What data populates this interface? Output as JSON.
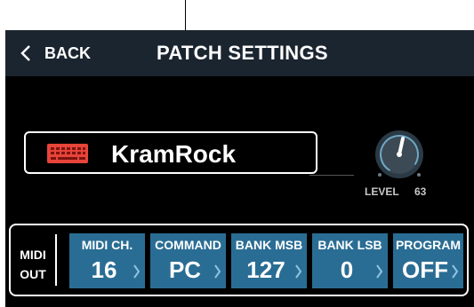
{
  "header": {
    "back_label": "BACK",
    "title": "PATCH SETTINGS"
  },
  "patch": {
    "name": "KramRock",
    "icon": "keyboard-icon"
  },
  "level": {
    "label": "LEVEL",
    "value": "63"
  },
  "midi": {
    "out_line1": "MIDI",
    "out_line2": "OUT",
    "params": [
      {
        "label": "MIDI CH.",
        "value": "16"
      },
      {
        "label": "COMMAND",
        "value": "PC"
      },
      {
        "label": "BANK MSB",
        "value": "127"
      },
      {
        "label": "BANK LSB",
        "value": "0"
      },
      {
        "label": "PROGRAM",
        "value": "OFF"
      }
    ]
  },
  "colors": {
    "header_bg": "#1b2530",
    "param_bg": "#2a6d94",
    "keyboard_icon": "#e8443a",
    "knob_accent": "#6fa8c8"
  }
}
